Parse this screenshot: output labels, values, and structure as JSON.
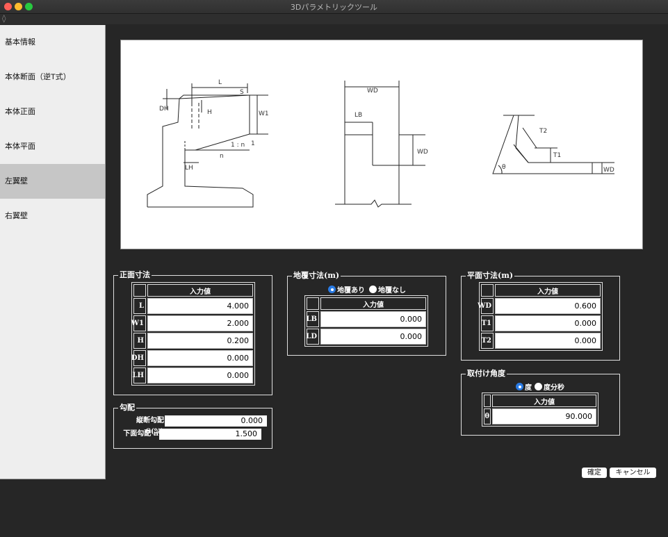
{
  "window": {
    "title": "3Dパラメトリックツール"
  },
  "toolbar": {
    "icon": "◊"
  },
  "sidebar": {
    "items": [
      {
        "label": "基本情報"
      },
      {
        "label": "本体断面（逆T式）"
      },
      {
        "label": "本体正面"
      },
      {
        "label": "本体平面"
      },
      {
        "label": "左翼壁"
      },
      {
        "label": "右翼壁"
      }
    ],
    "active_index": 4
  },
  "diagram": {
    "labels": {
      "L": "L",
      "S": "S",
      "DH": "DH",
      "H": "H",
      "W1": "W1",
      "ratio": "1 : n",
      "one": "1",
      "n": "n",
      "LH": "LH",
      "WD": "WD",
      "LB": "LB",
      "T1": "T1",
      "T2": "T2",
      "theta": "θ"
    }
  },
  "front": {
    "title": "正面寸法",
    "header": "入力値",
    "rows": [
      {
        "label": "L",
        "value": "4.000"
      },
      {
        "label": "W1",
        "value": "2.000"
      },
      {
        "label": "H",
        "value": "0.200"
      },
      {
        "label": "DH",
        "value": "0.000"
      },
      {
        "label": "LH",
        "value": "0.000"
      }
    ]
  },
  "slope": {
    "title": "勾配",
    "rows": [
      {
        "label": "縦断勾配 S(%)",
        "value": "0.000"
      },
      {
        "label": "下面勾配 n",
        "value": "1.500"
      }
    ]
  },
  "cover": {
    "title": "地覆寸法(m)",
    "radios": [
      {
        "label": "地覆あり",
        "checked": true
      },
      {
        "label": "地覆なし",
        "checked": false
      }
    ],
    "header": "入力値",
    "rows": [
      {
        "label": "LB",
        "value": "0.000"
      },
      {
        "label": "LD",
        "value": "0.000"
      }
    ]
  },
  "plan": {
    "title": "平面寸法(m)",
    "header": "入力値",
    "rows": [
      {
        "label": "WD",
        "value": "0.600"
      },
      {
        "label": "T1",
        "value": "0.000"
      },
      {
        "label": "T2",
        "value": "0.000"
      }
    ]
  },
  "angle": {
    "title": "取付け角度",
    "radios": [
      {
        "label": "度",
        "checked": true
      },
      {
        "label": "度分秒",
        "checked": false
      }
    ],
    "header": "入力値",
    "rows": [
      {
        "label": "θ",
        "value": "90.000"
      }
    ]
  },
  "buttons": {
    "ok": "確定",
    "cancel": "キャンセル"
  },
  "colors": {
    "background": "#262626",
    "sidebar": "#eeeeee",
    "sidebar_active": "#c6c6c6",
    "radio_checked": "#2a7be4",
    "close": "#fe5f57",
    "minimize": "#febc2e",
    "maximize": "#28c840"
  }
}
